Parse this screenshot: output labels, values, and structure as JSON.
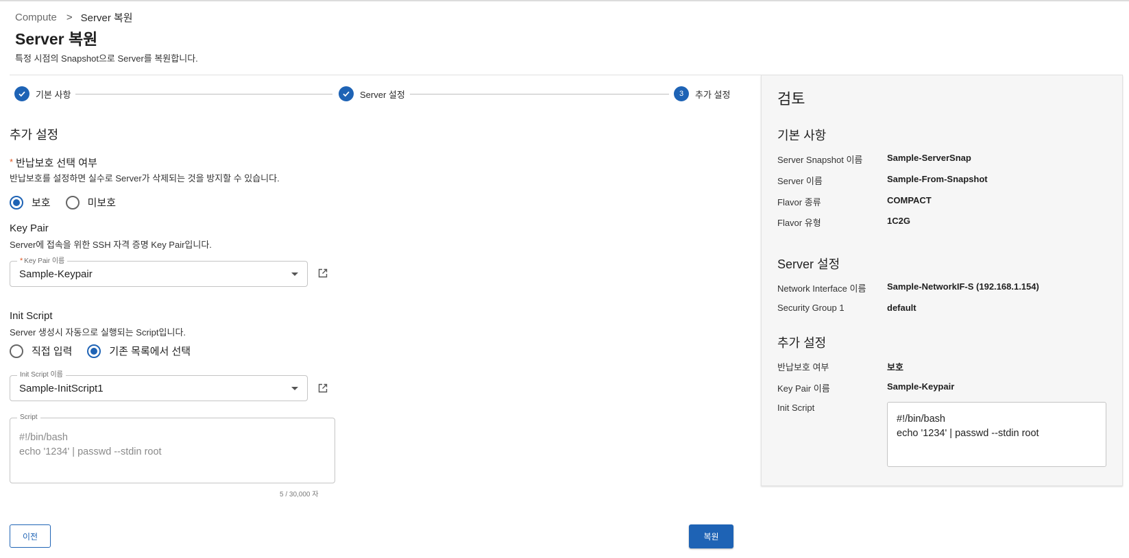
{
  "breadcrumb": {
    "root": "Compute",
    "separator": ">",
    "current": "Server 복원"
  },
  "page": {
    "title": "Server 복원",
    "description": "특정 시점의 Snapshot으로 Server를 복원합니다."
  },
  "stepper": {
    "steps": [
      {
        "label": "기본 사항",
        "state": "done"
      },
      {
        "label": "Server 설정",
        "state": "done"
      },
      {
        "label": "추가 설정",
        "state": "active",
        "number": "3"
      }
    ]
  },
  "form": {
    "section_title": "추가 설정",
    "protection": {
      "label": "반납보호 선택 여부",
      "required_mark": "*",
      "description": "반납보호를 설정하면 실수로 Server가 삭제되는 것을 방지할 수 있습니다.",
      "options": [
        "보호",
        "미보호"
      ],
      "selected": "보호"
    },
    "key_pair": {
      "label": "Key Pair",
      "description": "Server에 접속을 위한 SSH 자격 증명 Key Pair입니다.",
      "field_label": "Key Pair 이름",
      "required_mark": "*",
      "value": "Sample-Keypair"
    },
    "init_script": {
      "label": "Init Script",
      "description": "Server 생성시 자동으로 실행되는 Script입니다.",
      "options": [
        "직접 입력",
        "기존 목록에서 선택"
      ],
      "selected": "기존 목록에서 선택",
      "field_label": "Init Script 이름",
      "value": "Sample-InitScript1",
      "script_label": "Script",
      "script_text": "#!/bin/bash\necho '1234' | passwd --stdin root",
      "counter": "5 / 30,000 자"
    }
  },
  "buttons": {
    "prev": "이전",
    "restore": "복원"
  },
  "review": {
    "title": "검토",
    "sections": [
      {
        "title": "기본 사항",
        "rows": [
          {
            "key": "Server Snapshot 이름",
            "value": "Sample-ServerSnap"
          },
          {
            "key": "Server 이름",
            "value": "Sample-From-Snapshot"
          },
          {
            "key": "Flavor 종류",
            "value": "COMPACT"
          },
          {
            "key": "Flavor 유형",
            "value": "1C2G"
          }
        ]
      },
      {
        "title": "Server 설정",
        "rows": [
          {
            "key": "Network Interface 이름",
            "value": "Sample-NetworkIF-S (192.168.1.154)"
          },
          {
            "key": "Security Group 1",
            "value": "default"
          }
        ]
      },
      {
        "title": "추가 설정",
        "rows": [
          {
            "key": "반납보호 여부",
            "value": "보호"
          },
          {
            "key": "Key Pair 이름",
            "value": "Sample-Keypair"
          },
          {
            "key": "Init Script",
            "value": "#!/bin/bash\necho '1234' | passwd --stdin root"
          }
        ]
      }
    ]
  },
  "colors": {
    "primary": "#1e63b5",
    "required": "#e0551f",
    "panel_bg": "#f6f6f6"
  },
  "icons": {
    "step_done": "check-icon",
    "external_link": "open-in-new-icon",
    "dropdown": "caret-down-icon"
  }
}
